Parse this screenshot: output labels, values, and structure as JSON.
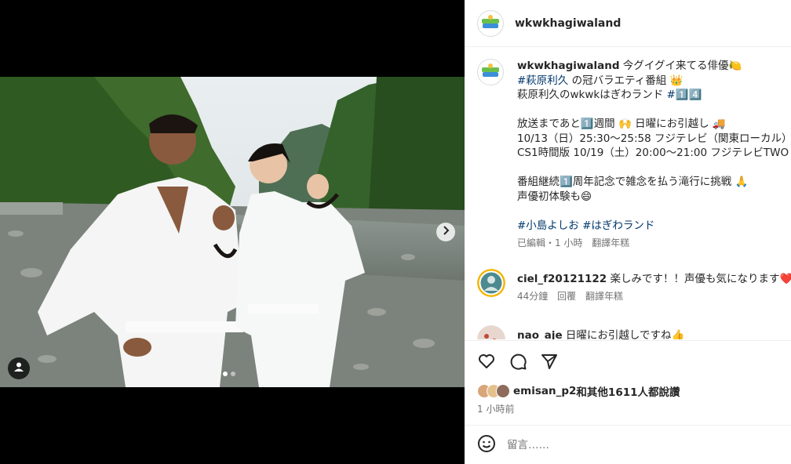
{
  "post": {
    "username": "wkwkhagiwaland"
  },
  "caption": {
    "username": "wkwkhagiwaland",
    "line1": " 今グイグイ来てる俳優🍋",
    "line2_tag": "#萩原利久",
    "line2_rest": " の冠バラエティ番組 👑",
    "line3_text": "萩原利久のwkwkはぎわランド ",
    "line3_tag": "#1️⃣4️⃣",
    "line4": "放送まであと1️⃣週間 🙌 日曜にお引越し 🚚",
    "line5": "10/13（日）25:30～25:58 フジテレビ（関東ローカル）",
    "line6": "CS1時間版 10/19（土）20:00～21:00 フジテレビTWO",
    "line7": "番組継続1️⃣周年記念で雑念を払う滝行に挑戦 🙏",
    "line8": "声優初体験も😄",
    "tags": "#小島よしお #はぎわランド",
    "edited": "已編輯・1 小時",
    "translate": "翻譯年糕"
  },
  "comments": [
    {
      "username": "ciel_f20121122",
      "text": " 楽しみです！！声優も気になります❤️",
      "time": "44分鐘",
      "reply": "回覆",
      "translate": "翻譯年糕"
    },
    {
      "username": "nao_aje",
      "text": " 日曜にお引越しですね👍"
    }
  ],
  "likes": {
    "first_user": "emisan_p2",
    "rest": "和其他1611人都說讚"
  },
  "time_ago": "1 小時前",
  "comment_input": {
    "placeholder": "留言……"
  },
  "icons": {
    "like": "heart-icon",
    "comment": "comment-icon",
    "share": "send-icon",
    "emoji": "emoji-icon",
    "next": "chevron-right-icon",
    "tag": "user-tag-icon"
  },
  "colors": {
    "link": "#00376b",
    "muted": "#737373",
    "border": "#efefef"
  }
}
